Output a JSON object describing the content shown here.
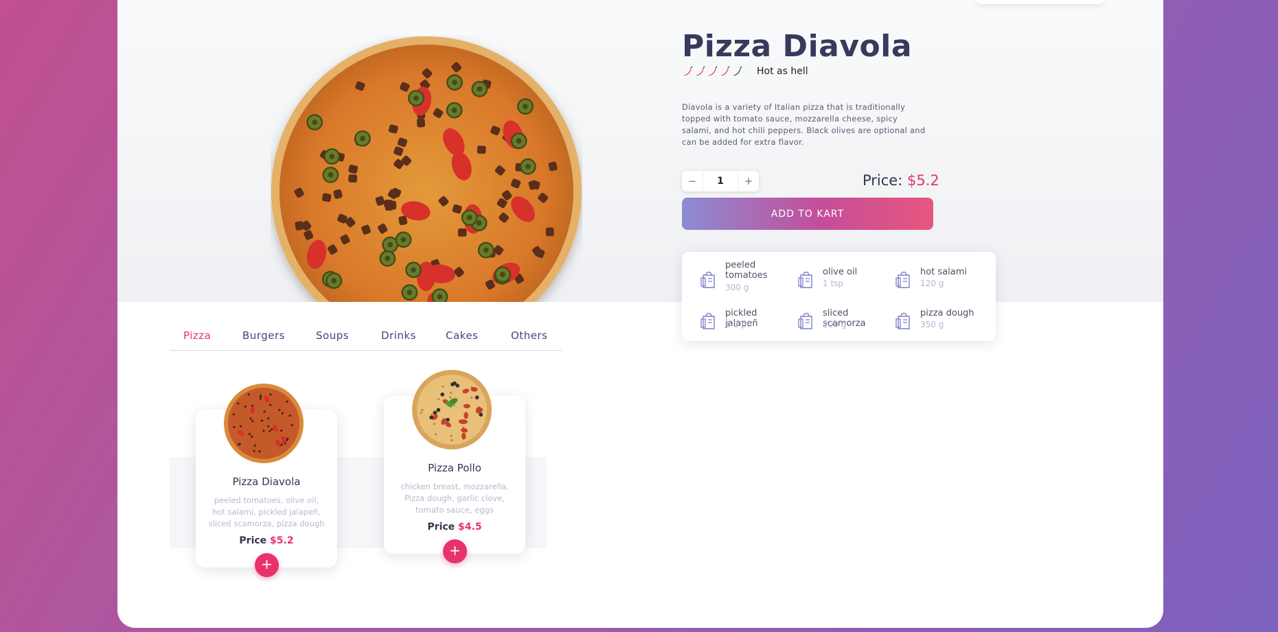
{
  "product": {
    "title": "Pizza Diavola",
    "heat_level": 4,
    "heat_max": 5,
    "heat_label": "Hot as hell",
    "description": "Diavola is a variety of Italian pizza that is traditionally topped with tomato sauce, mozzarella cheese, spicy salami, and hot chili peppers. Black olives are optional and can be added for extra flavor.",
    "quantity": "1",
    "minus": "−",
    "plus": "+",
    "price_label": "Price:",
    "price_value": "$5.2",
    "add_button": "ADD TO KART"
  },
  "ingredients": [
    {
      "name": "peeled tomatoes",
      "amount": "300 g"
    },
    {
      "name": "olive oil",
      "amount": "1 tsp"
    },
    {
      "name": "hot salami",
      "amount": "120 g"
    },
    {
      "name": "pickled jalapeñ",
      "amount": "1-2 pc"
    },
    {
      "name": "sliced scamorza",
      "amount": "200 g"
    },
    {
      "name": "pizza dough",
      "amount": "350 g"
    }
  ],
  "tabs": [
    "Pizza",
    "Burgers",
    "Soups",
    "Drinks",
    "Cakes",
    "Others"
  ],
  "active_tab": "Pizza",
  "cards": [
    {
      "name": "Pizza Diavola",
      "desc": "peeled tomatoes, olive oil, hot salami, pickled jalapeñ, sliced scamorza, pizza dough",
      "price_label": "Price",
      "price_value": "$5.2",
      "add": "+"
    },
    {
      "name": "Pizza Pollo",
      "desc": "chicken breast, mozzarella, Pizza dough, garlic clove, tomato sauce, eggs",
      "price_label": "Price",
      "price_value": "$4.5",
      "add": "+"
    }
  ],
  "colors": {
    "accent": "#e8336a",
    "title": "#383a5c",
    "tab": "#4a3f7a",
    "ingredient_icon": "#7b7fc9"
  }
}
